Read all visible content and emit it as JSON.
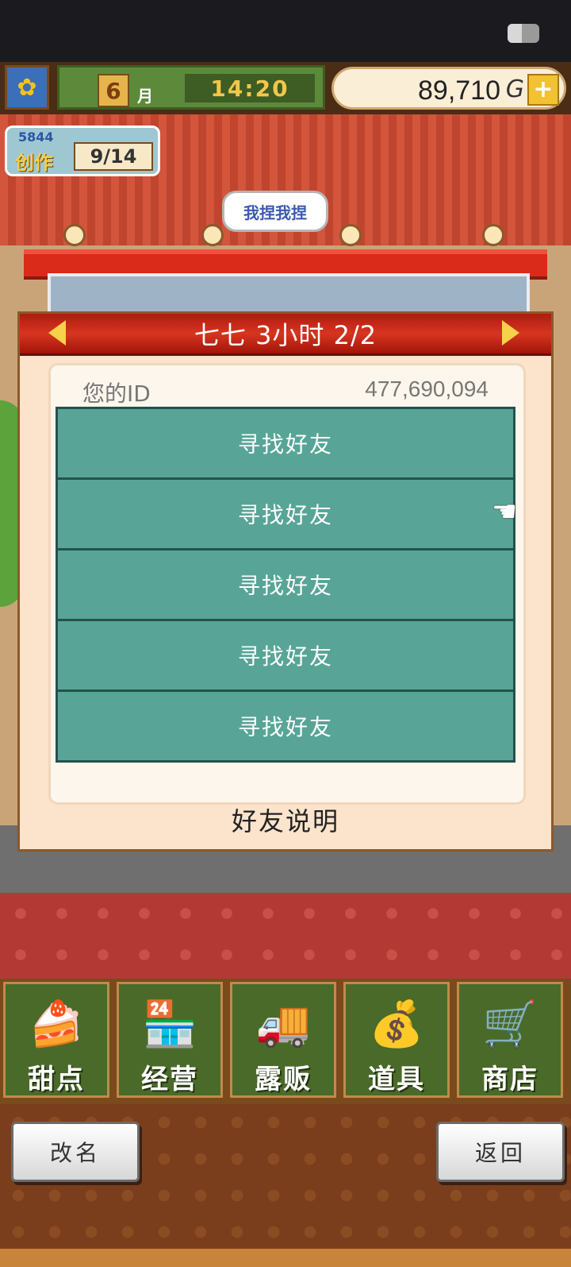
{
  "hud": {
    "month": "6",
    "month_label": "月",
    "time": "14:20",
    "money": "89,710",
    "money_unit": "G",
    "plus": "+"
  },
  "scene": {
    "creation_score": "5844",
    "creation_label": "创作",
    "creation_count": "9/14",
    "speech": "我捏我捏"
  },
  "dialog": {
    "title": "七七  3小时 2/2",
    "id_label": "您的ID",
    "id_value": "477,690,094",
    "friend_slots": [
      "寻找好友",
      "寻找好友",
      "寻找好友",
      "寻找好友",
      "寻找好友"
    ],
    "help_label": "好友说明"
  },
  "menu": {
    "items": [
      {
        "label": "甜点",
        "icon": "cake-icon"
      },
      {
        "label": "经营",
        "icon": "shop-building-icon"
      },
      {
        "label": "露贩",
        "icon": "food-truck-icon"
      },
      {
        "label": "道具",
        "icon": "item-bag-icon"
      },
      {
        "label": "商店",
        "icon": "shopping-cart-icon"
      }
    ]
  },
  "footer": {
    "rename": "改名",
    "back": "返回"
  },
  "colors": {
    "dialog_header": "#c4281a",
    "friend_slot": "#58a597",
    "menu_tile": "#4a6a2a",
    "arrow": "#f6d24a"
  }
}
